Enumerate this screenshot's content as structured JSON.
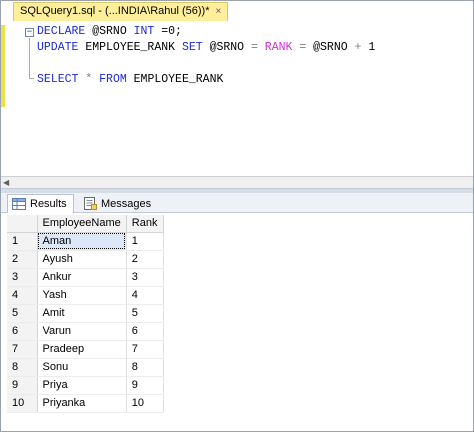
{
  "editor_tab": {
    "title": "SQLQuery1.sql - (...INDIA\\Rahul (56))*",
    "close_glyph": "×"
  },
  "code": {
    "line1": {
      "declare": "DECLARE",
      "var": " @SRNO ",
      "type": "INT",
      "rest": " =0;"
    },
    "line2": {
      "update": "UPDATE",
      "table": " EMPLOYEE_RANK ",
      "set": "SET",
      "p1": " @SRNO ",
      "eq1": "=",
      "rank": " RANK ",
      "eq2": "=",
      "p2": " @SRNO ",
      "plus": "+",
      "p3": " 1"
    },
    "line3": {
      "select": "SELECT",
      "star": " * ",
      "from": "FROM",
      "table": " EMPLOYEE_RANK"
    }
  },
  "results_tabs": {
    "results": "Results",
    "messages": "Messages"
  },
  "grid": {
    "columns": [
      "EmployeeName",
      "Rank"
    ],
    "rows": [
      {
        "n": "1",
        "name": "Aman",
        "rank": "1"
      },
      {
        "n": "2",
        "name": "Ayush",
        "rank": "2"
      },
      {
        "n": "3",
        "name": "Ankur",
        "rank": "3"
      },
      {
        "n": "4",
        "name": "Yash",
        "rank": "4"
      },
      {
        "n": "5",
        "name": "Amit",
        "rank": "5"
      },
      {
        "n": "6",
        "name": "Varun",
        "rank": "6"
      },
      {
        "n": "7",
        "name": "Pradeep",
        "rank": "7"
      },
      {
        "n": "8",
        "name": "Sonu",
        "rank": "8"
      },
      {
        "n": "9",
        "name": "Priya",
        "rank": "9"
      },
      {
        "n": "10",
        "name": "Priyanka",
        "rank": "10"
      }
    ]
  },
  "colors": {
    "keyword": "#1d2bd6",
    "function": "#d12fd1",
    "operator": "#808080",
    "tab_active": "#ffef9a"
  },
  "icons": {
    "results_tab": "grid-icon",
    "messages_tab": "messages-icon",
    "collapse": "collapse-minus-icon"
  }
}
